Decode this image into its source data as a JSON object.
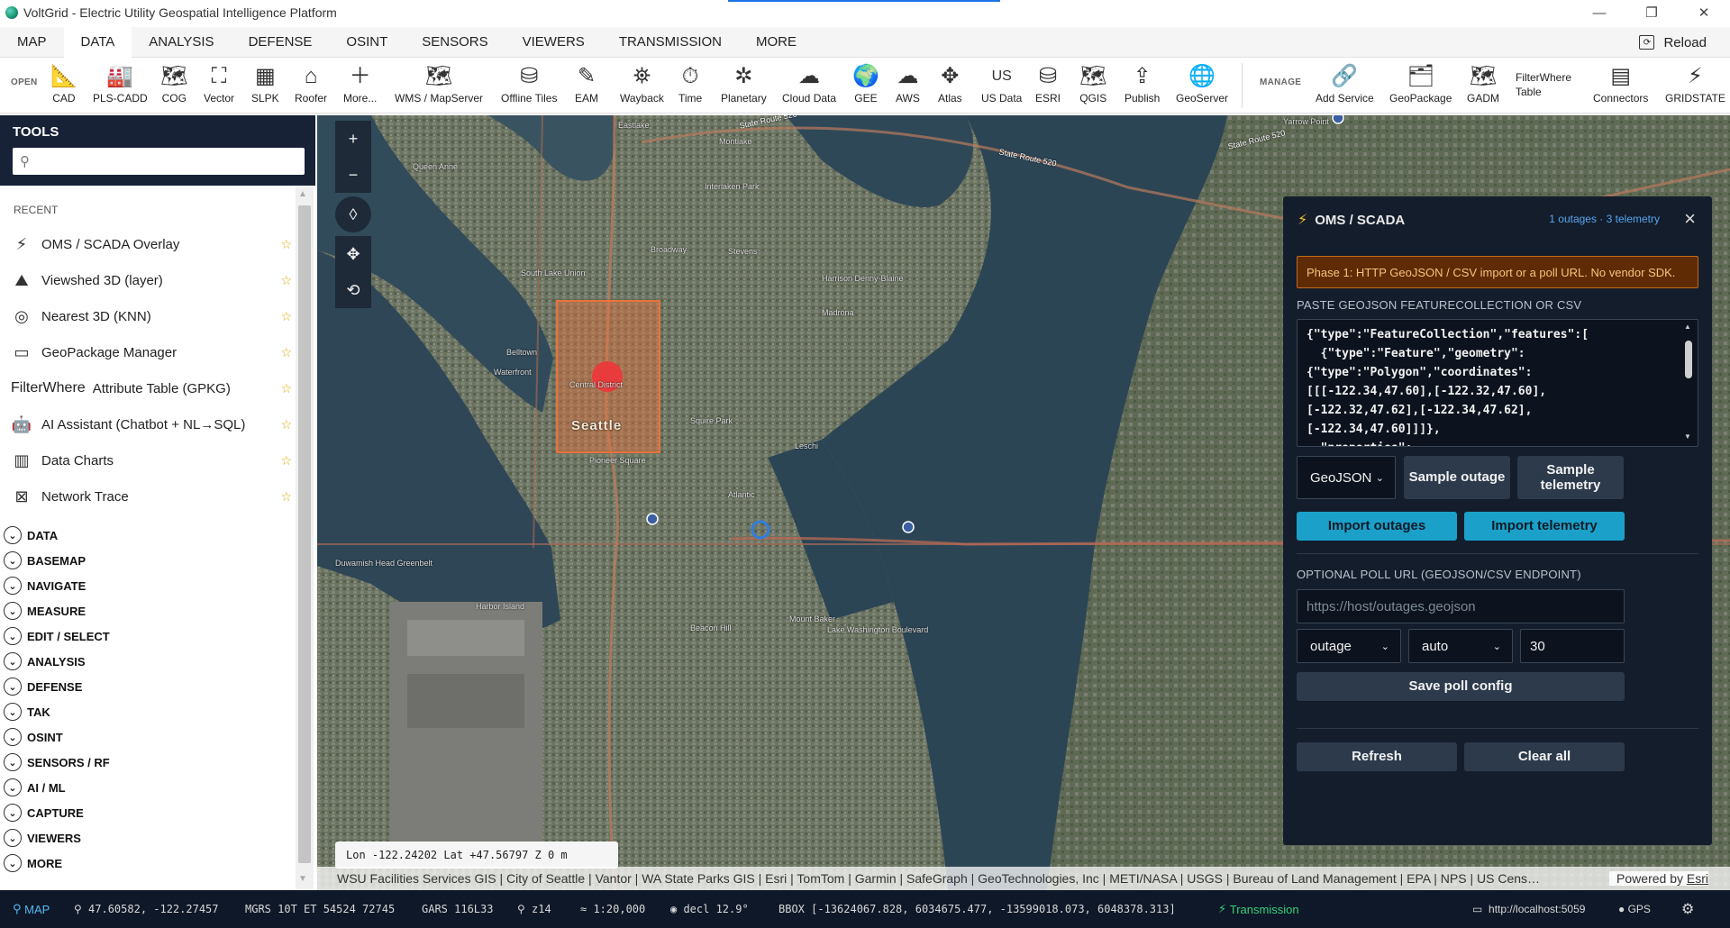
{
  "window": {
    "title": "VoltGrid - Electric Utility Geospatial Intelligence Platform",
    "controls": [
      "—",
      "❐",
      "✕"
    ]
  },
  "menu": {
    "tabs": [
      "MAP",
      "DATA",
      "ANALYSIS",
      "DEFENSE",
      "OSINT",
      "SENSORS",
      "VIEWERS",
      "TRANSMISSION",
      "MORE"
    ],
    "active": "DATA",
    "reload": "Reload"
  },
  "ribbon": {
    "open_label": "OPEN",
    "manage_label": "MANAGE",
    "open_items": [
      {
        "label": "CAD",
        "icon": "cad-icon"
      },
      {
        "label": "PLS-CADD",
        "icon": "pls-cadd-icon"
      },
      {
        "label": "COG",
        "icon": "cog-icon"
      },
      {
        "label": "Vector",
        "icon": "vector-icon"
      },
      {
        "label": "SLPK",
        "icon": "slpk-icon"
      },
      {
        "label": "Roofer",
        "icon": "roofer-icon"
      },
      {
        "label": "More...",
        "icon": "plus-icon"
      },
      {
        "label": "WMS / MapServer",
        "icon": "wms-icon"
      },
      {
        "label": "Offline Tiles",
        "icon": "offline-tiles-icon"
      },
      {
        "label": "EAM",
        "icon": "eam-icon"
      },
      {
        "label": "Wayback",
        "icon": "wayback-icon"
      },
      {
        "label": "Time",
        "icon": "time-icon"
      },
      {
        "label": "Planetary",
        "icon": "planetary-icon"
      },
      {
        "label": "Cloud Data",
        "icon": "cloud-icon"
      },
      {
        "label": "GEE",
        "icon": "gee-icon"
      },
      {
        "label": "AWS",
        "icon": "aws-icon"
      },
      {
        "label": "Atlas",
        "icon": "atlas-icon"
      },
      {
        "label": "US Data",
        "icon": "us-icon",
        "glyph": "US"
      },
      {
        "label": "ESRI",
        "icon": "esri-icon"
      },
      {
        "label": "QGIS",
        "icon": "qgis-icon"
      },
      {
        "label": "Publish",
        "icon": "publish-icon"
      },
      {
        "label": "GeoServer",
        "icon": "geoserver-icon"
      }
    ],
    "manage_items": [
      {
        "label": "Add Service",
        "icon": "add-service-icon"
      },
      {
        "label": "GeoPackage",
        "icon": "geopackage-icon"
      },
      {
        "label": "GADM",
        "icon": "gadm-icon"
      },
      {
        "label": "Connectors",
        "icon": "connectors-icon"
      },
      {
        "label": "GRIDSTATE",
        "icon": "gridstate-icon"
      }
    ],
    "filterwhere": {
      "line1": "FilterWhere",
      "line2": "Table"
    }
  },
  "sidebar": {
    "title": "TOOLS",
    "search_placeholder": "",
    "recent_label": "RECENT",
    "recent": [
      {
        "label": "OMS / SCADA Overlay",
        "icon": "bolt-icon"
      },
      {
        "label": "Viewshed 3D (layer)",
        "icon": "viewshed-icon"
      },
      {
        "label": "Nearest 3D (KNN)",
        "icon": "target-icon"
      },
      {
        "label": "GeoPackage Manager",
        "icon": "folder-icon"
      },
      {
        "label": "Attribute Table (GPKG)",
        "prefix": "FilterWhere",
        "icon": ""
      },
      {
        "label": "AI Assistant (Chatbot + NL→SQL)",
        "icon": "ai-icon"
      },
      {
        "label": "Data Charts",
        "icon": "chart-icon"
      },
      {
        "label": "Network Trace",
        "icon": "network-icon"
      }
    ],
    "groups": [
      "DATA",
      "BASEMAP",
      "NAVIGATE",
      "MEASURE",
      "EDIT / SELECT",
      "ANALYSIS",
      "DEFENSE",
      "TAK",
      "OSINT",
      "SENSORS / RF",
      "AI / ML",
      "CAPTURE",
      "VIEWERS",
      "MORE"
    ]
  },
  "map": {
    "labels": [
      "Seattle",
      "State Route 520",
      "State Route 520",
      "State Route 520",
      "Yarrow Point",
      "Queen Anne",
      "Interlaken Park",
      "Broadway",
      "Montlake",
      "Eastlake",
      "Harrison Denny-Blaine",
      "Central District",
      "Squire Park",
      "Leschi",
      "Atlantic",
      "Pioneer Square",
      "Duwamish Head Greenbelt",
      "Harbor Island",
      "Beacon Hill",
      "Mount Baker",
      "Lake Washington Boulevard",
      "South Lake Union",
      "Belltown",
      "Stevens",
      "Madrona",
      "Waterfront"
    ],
    "coords": "Lon -122.24202   Lat +47.56797   Z 0 m",
    "attribution": "WSU Facilities Services GIS | City of Seattle | Vantor | WA State Parks GIS | Esri | TomTom | Garmin | SafeGraph | GeoTechnologies, Inc | METI/NASA | USGS | Bureau of Land Management | EPA | NPS | US Cens…",
    "powered_by": "Powered by",
    "powered_brand": "Esri",
    "controls": {
      "zoom_in": "+",
      "zoom_out": "−"
    }
  },
  "oms": {
    "title": "OMS / SCADA",
    "status": "1 outages · 3 telemetry",
    "warning": "Phase 1: HTTP GeoJSON / CSV import or a poll URL. No vendor SDK.",
    "paste_label": "PASTE GEOJSON FEATURECOLLECTION OR CSV",
    "textarea": "{\"type\":\"FeatureCollection\",\"features\":[\n  {\"type\":\"Feature\",\"geometry\":\n{\"type\":\"Polygon\",\"coordinates\":\n[[[-122.34,47.60],[-122.32,47.60],\n[-122.32,47.62],[-122.34,47.62],\n[-122.34,47.60]]]},\n  \"properties\":",
    "format": "GeoJSON",
    "sample_outage": "Sample outage",
    "sample_telemetry": "Sample telemetry",
    "import_outages": "Import outages",
    "import_telemetry": "Import telemetry",
    "poll_label": "OPTIONAL POLL URL (GEOJSON/CSV ENDPOINT)",
    "poll_placeholder": "https://host/outages.geojson",
    "poll_kind": "outage",
    "poll_format": "auto",
    "poll_interval": "30",
    "save_poll": "Save poll config",
    "refresh": "Refresh",
    "clear_all": "Clear all"
  },
  "statusbar": {
    "map_mode": "MAP",
    "latlon": "47.60582, -122.27457",
    "mgrs": "MGRS 10T ET 54524 72745",
    "gars": "GARS 116L33",
    "zoom": "z14",
    "scale": "≈ 1:20,000",
    "decl": "decl 12.9°",
    "bbox": "BBOX [-13624067.828, 6034675.477, -13599018.073, 6048378.313]",
    "transmission": "Transmission",
    "server": "http://localhost:5059",
    "gps": "GPS"
  },
  "colors": {
    "panel_bg": "#141d2b",
    "accent": "#1ba0c9",
    "warning": "#5e2b05",
    "outage_fill": "#e8733d",
    "outage_point": "#e93b3b",
    "telemetry_point": "#2f7ee0"
  }
}
